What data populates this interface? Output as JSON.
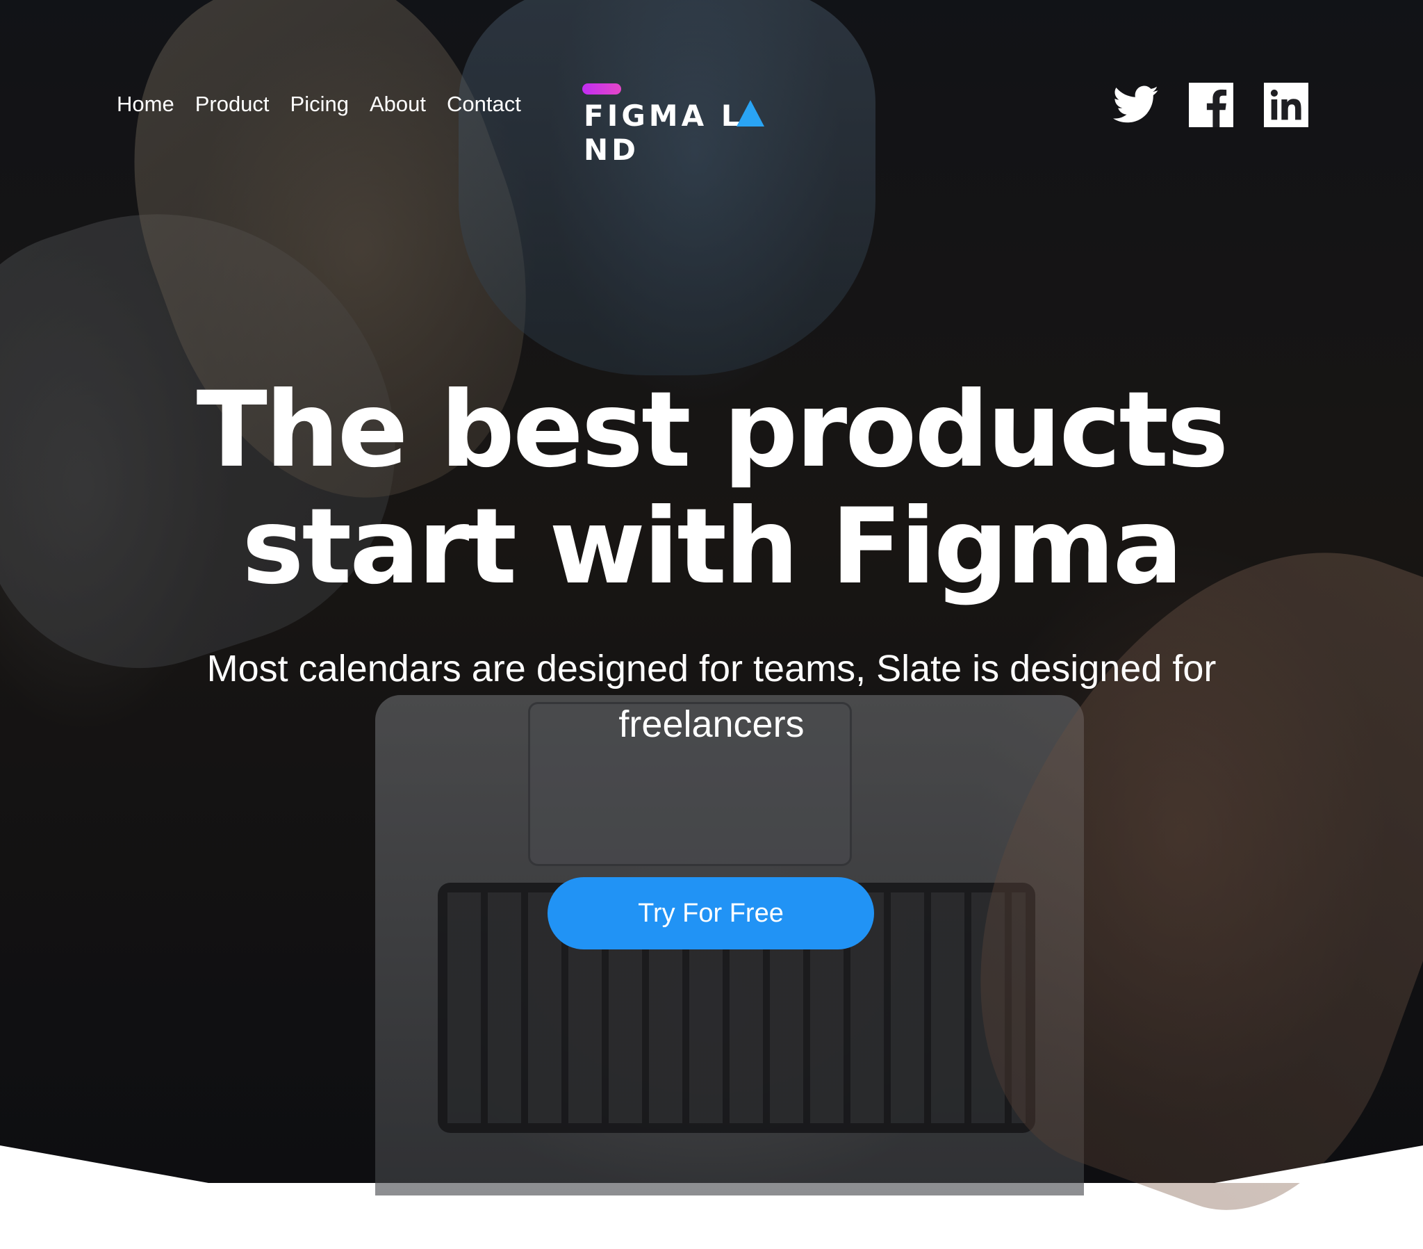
{
  "nav": {
    "items": [
      {
        "label": "Home"
      },
      {
        "label": "Product"
      },
      {
        "label": "Picing"
      },
      {
        "label": "About"
      },
      {
        "label": "Contact"
      }
    ]
  },
  "logo": {
    "text_part1": "FIGMA L",
    "text_part2": "ND",
    "bar_color": "#c12df2",
    "triangle_color": "#2aa4f4"
  },
  "social": {
    "icons": [
      "twitter-icon",
      "facebook-icon",
      "linkedin-icon"
    ]
  },
  "hero": {
    "headline_line1": "The best products",
    "headline_line2": "start with Figma",
    "subtitle": "Most calendars are designed for teams, Slate is designed for freelancers",
    "cta_label": "Try For Free",
    "cta_color": "#2193f5"
  }
}
